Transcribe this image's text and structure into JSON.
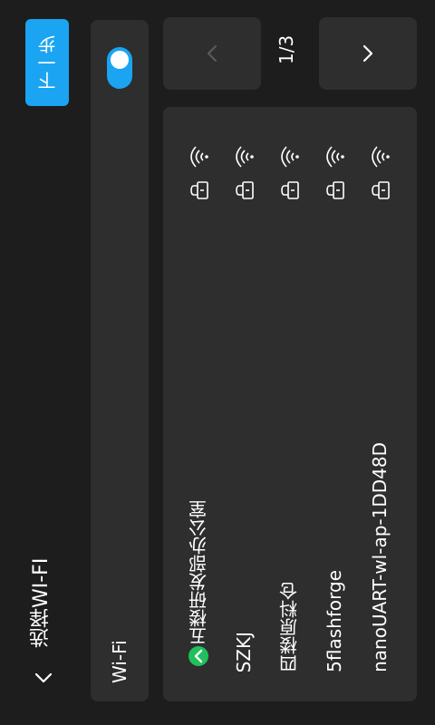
{
  "header": {
    "title": "选择WI-FI",
    "next_label": "下一步"
  },
  "wifi": {
    "label": "Wi-Fi",
    "enabled": true
  },
  "pager": {
    "indicator": "1/3"
  },
  "networks": [
    {
      "name": "五楼研发部办公室",
      "connected": true,
      "secured": true
    },
    {
      "name": "SZKJ",
      "connected": false,
      "secured": true
    },
    {
      "name": "四楼原料仓",
      "connected": false,
      "secured": true
    },
    {
      "name": "5flashforge",
      "connected": false,
      "secured": true
    },
    {
      "name": "nanoUART-wl-ap-1DD48D",
      "connected": false,
      "secured": true
    }
  ],
  "colors": {
    "background": "#1d1d1d",
    "panel": "#2e2e2e",
    "accent": "#1aa4f2",
    "connected": "#20c05c"
  }
}
